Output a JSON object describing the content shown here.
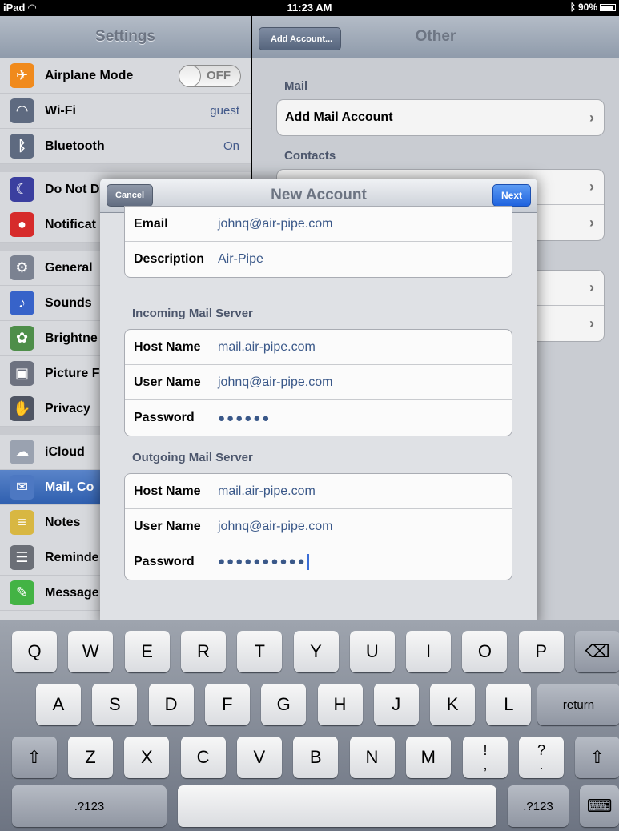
{
  "status_bar": {
    "device": "iPad",
    "time": "11:23 AM",
    "battery": "90%"
  },
  "master": {
    "title": "Settings",
    "items": [
      {
        "label": "Airplane Mode",
        "toggle": "OFF",
        "icon": "airplane-icon",
        "color": "#f08a1c"
      },
      {
        "label": "Wi-Fi",
        "value": "guest",
        "icon": "wifi-icon",
        "color": "#5e6a80"
      },
      {
        "label": "Bluetooth",
        "value": "On",
        "icon": "bluetooth-icon",
        "color": "#5e6a80"
      },
      {
        "label": "Do Not D",
        "icon": "moon-icon",
        "color": "#3b3f9f"
      },
      {
        "label": "Notificat",
        "icon": "notification-icon",
        "color": "#d62b2b"
      },
      {
        "label": "General",
        "icon": "gear-icon",
        "color": "#7b8291"
      },
      {
        "label": "Sounds",
        "icon": "speaker-icon",
        "color": "#3763c9"
      },
      {
        "label": "Brightne",
        "icon": "flower-icon",
        "color": "#4e8e4a"
      },
      {
        "label": "Picture F",
        "icon": "picture-frame-icon",
        "color": "#6d7280"
      },
      {
        "label": "Privacy",
        "icon": "hand-icon",
        "color": "#4f5563"
      },
      {
        "label": "iCloud",
        "icon": "cloud-icon",
        "color": "#9aa2b0"
      },
      {
        "label": "Mail, Co",
        "icon": "mail-icon",
        "color": "#4d78c2"
      },
      {
        "label": "Notes",
        "icon": "notes-icon",
        "color": "#d8b742"
      },
      {
        "label": "Reminde",
        "icon": "reminders-icon",
        "color": "#6b6f77"
      },
      {
        "label": "Message",
        "icon": "message-icon",
        "color": "#43b344"
      }
    ]
  },
  "detail": {
    "back_label": "Add Account...",
    "title": "Other",
    "mail_header": "Mail",
    "add_mail_account": "Add Mail Account",
    "contacts_header": "Contacts"
  },
  "modal": {
    "cancel_label": "Cancel",
    "title": "New Account",
    "next_label": "Next",
    "account": {
      "email_label": "Email",
      "email_value": "johnq@air-pipe.com",
      "description_label": "Description",
      "description_value": "Air-Pipe"
    },
    "incoming": {
      "header": "Incoming Mail Server",
      "host_label": "Host Name",
      "host_value": "mail.air-pipe.com",
      "user_label": "User Name",
      "user_value": "johnq@air-pipe.com",
      "password_label": "Password",
      "password_value": "●●●●●●"
    },
    "outgoing": {
      "header": "Outgoing Mail Server",
      "host_label": "Host Name",
      "host_value": "mail.air-pipe.com",
      "user_label": "User Name",
      "user_value": "johnq@air-pipe.com",
      "password_label": "Password",
      "password_value": "●●●●●●●●●●"
    }
  },
  "keyboard": {
    "row1": [
      "Q",
      "W",
      "E",
      "R",
      "T",
      "Y",
      "U",
      "I",
      "O",
      "P"
    ],
    "row2": [
      "A",
      "S",
      "D",
      "F",
      "G",
      "H",
      "J",
      "K",
      "L"
    ],
    "row3": [
      "Z",
      "X",
      "C",
      "V",
      "B",
      "N",
      "M"
    ],
    "return_label": "return",
    "numbers_label": ".?123",
    "exclaim_top": "!",
    "exclaim_bottom": ",",
    "question_top": "?",
    "question_bottom": "."
  }
}
